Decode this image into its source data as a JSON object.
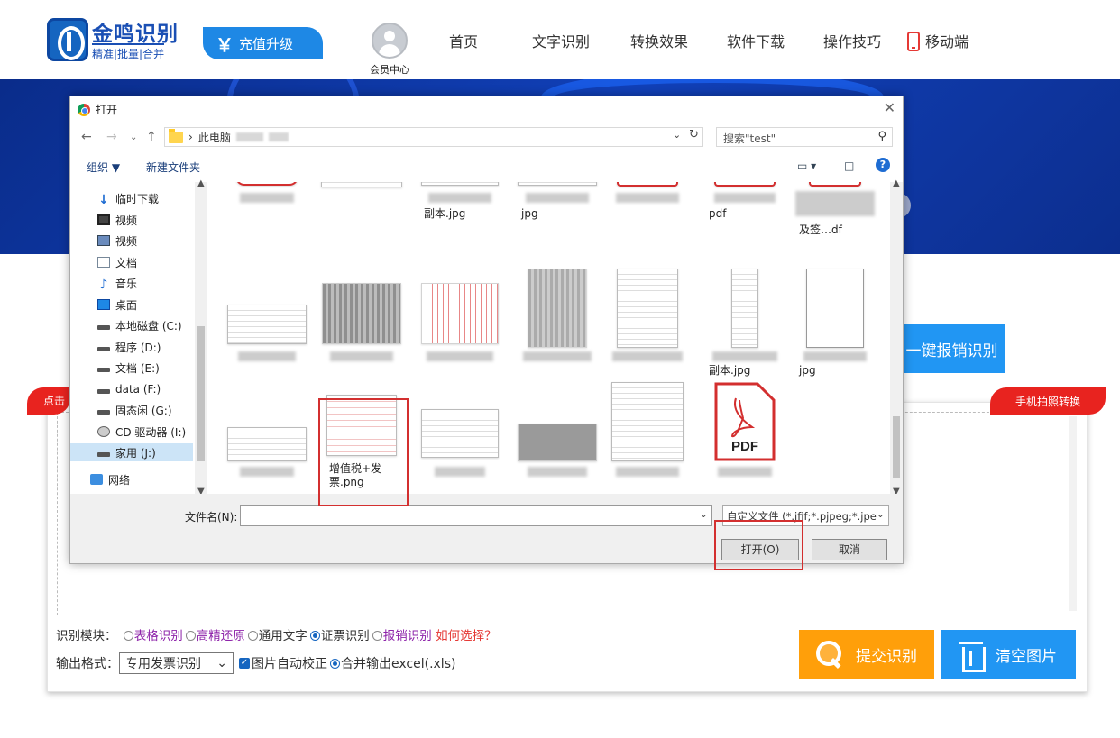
{
  "header": {
    "logo_name": "金鸣识别",
    "logo_slogan": "精准|批量|合并",
    "recharge_symbol": "￥",
    "recharge_label": "充值升级",
    "member_label": "会员中心",
    "nav": [
      "首页",
      "文字识别",
      "转换效果",
      "软件下载",
      "操作技巧"
    ],
    "mobile_label": "移动端"
  },
  "main": {
    "bill_button": "一键报销识别",
    "left_tag": "点击",
    "right_tag": "手机拍照转换",
    "module_label": "识别模块：",
    "modules": [
      {
        "label": "表格识别",
        "checked": false,
        "color": "#8e24aa"
      },
      {
        "label": "高精还原",
        "checked": false,
        "color": "#8e24aa"
      },
      {
        "label": "通用文字",
        "checked": false,
        "color": "#333333"
      },
      {
        "label": "证票识别",
        "checked": true,
        "color": "#333333"
      },
      {
        "label": "报销识别",
        "checked": false,
        "color": "#8e24aa"
      }
    ],
    "how_to_choose": "如何选择？",
    "output_label": "输出格式：",
    "output_format": "专用发票识别",
    "auto_correct_label": "图片自动校正",
    "merge_output_label": "合并输出excel(.xls)",
    "submit_label": "提交识别",
    "clear_label": "清空图片"
  },
  "dialog": {
    "title": "打开",
    "path_root": "此电脑",
    "search_placeholder": "搜索\"test\"",
    "organize_label": "组织 ▼",
    "new_folder_label": "新建文件夹",
    "help": "?",
    "nav_items": [
      {
        "label": "临时下载",
        "icon": "download-arrow-icon"
      },
      {
        "label": "视频",
        "icon": "film-icon"
      },
      {
        "label": "视频",
        "icon": "video-icon"
      },
      {
        "label": "文档",
        "icon": "document-icon"
      },
      {
        "label": "音乐",
        "icon": "music-icon"
      },
      {
        "label": "桌面",
        "icon": "desktop-icon"
      },
      {
        "label": "本地磁盘 (C:)",
        "icon": "drive-icon"
      },
      {
        "label": "程序 (D:)",
        "icon": "drive-icon"
      },
      {
        "label": "文档 (E:)",
        "icon": "drive-icon"
      },
      {
        "label": "data (F:)",
        "icon": "drive-icon"
      },
      {
        "label": "固态闲 (G:)",
        "icon": "drive-icon"
      },
      {
        "label": "CD 驱动器 (I:)",
        "icon": "cd-icon"
      },
      {
        "label": "家用 (J:)",
        "icon": "drive-icon"
      },
      {
        "label": "网络",
        "icon": "network-icon"
      }
    ],
    "row1_names": [
      "",
      "",
      "副本.jpg",
      "jpg",
      "",
      "pdf",
      "及签…df"
    ],
    "row2_names": [
      "",
      "",
      "",
      "",
      "",
      "副本.jpg",
      "jpg"
    ],
    "selected_file": "增值税+发票.png",
    "pdf_label": "PDF",
    "filename_label": "文件名(N):",
    "filename_value": "",
    "filetype": "自定义文件 (*.jfif;*.pjpeg;*.jpe",
    "open_label": "打开(O)",
    "cancel_label": "取消"
  }
}
